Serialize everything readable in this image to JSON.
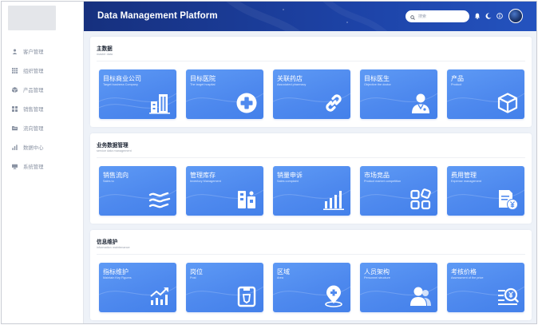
{
  "header": {
    "title": "Data Management Platform",
    "search_placeholder": "搜索"
  },
  "sidebar": {
    "items": [
      {
        "label": "客户管理",
        "icon": "user-icon"
      },
      {
        "label": "组织管理",
        "icon": "grid-icon"
      },
      {
        "label": "产品管理",
        "icon": "box-icon"
      },
      {
        "label": "销售管理",
        "icon": "apps-icon"
      },
      {
        "label": "流向管理",
        "icon": "folder-icon"
      },
      {
        "label": "数据中心",
        "icon": "bar-chart-icon"
      },
      {
        "label": "系统管理",
        "icon": "monitor-icon"
      }
    ]
  },
  "sections": [
    {
      "title": "主数据",
      "subtitle": "master data",
      "cards": [
        {
          "title": "目标商业公司",
          "subtitle": "Target business Company",
          "icon": "buildings-icon"
        },
        {
          "title": "目标医院",
          "subtitle": "The target hospital",
          "icon": "medical-cross-icon"
        },
        {
          "title": "关联药店",
          "subtitle": "Associated pharmacy",
          "icon": "link-icon"
        },
        {
          "title": "目标医生",
          "subtitle": "Objective the doctor",
          "icon": "doctor-icon"
        },
        {
          "title": "产品",
          "subtitle": "Product",
          "icon": "package-icon"
        }
      ]
    },
    {
      "title": "业务数据管理",
      "subtitle": "service data management",
      "cards": [
        {
          "title": "销售流向",
          "subtitle": "Sales to",
          "icon": "flow-icon"
        },
        {
          "title": "管理库存",
          "subtitle": "Inventory Management",
          "icon": "warehouse-icon"
        },
        {
          "title": "销量申诉",
          "subtitle": "Sales complaint",
          "icon": "bar-chart-icon"
        },
        {
          "title": "市场竞品",
          "subtitle": "Product market competition",
          "icon": "blocks-icon"
        },
        {
          "title": "费用管理",
          "subtitle": "Expense management",
          "icon": "invoice-yen-icon"
        }
      ]
    },
    {
      "title": "信息维护",
      "subtitle": "information maintenance",
      "cards": [
        {
          "title": "指标维护",
          "subtitle": "Maintain Key Figures",
          "icon": "trend-chart-icon"
        },
        {
          "title": "岗位",
          "subtitle": "Post",
          "icon": "badge-icon"
        },
        {
          "title": "区域",
          "subtitle": "Area",
          "icon": "location-pin-icon"
        },
        {
          "title": "人员架构",
          "subtitle": "Personnel structure",
          "icon": "people-icon"
        },
        {
          "title": "考核价格",
          "subtitle": "Assessment of the price",
          "icon": "price-search-icon"
        }
      ]
    }
  ],
  "colors": {
    "header_dark": "#16307e",
    "header_light": "#2453bf",
    "card": "#4e89ee",
    "background": "#eef2f8"
  }
}
